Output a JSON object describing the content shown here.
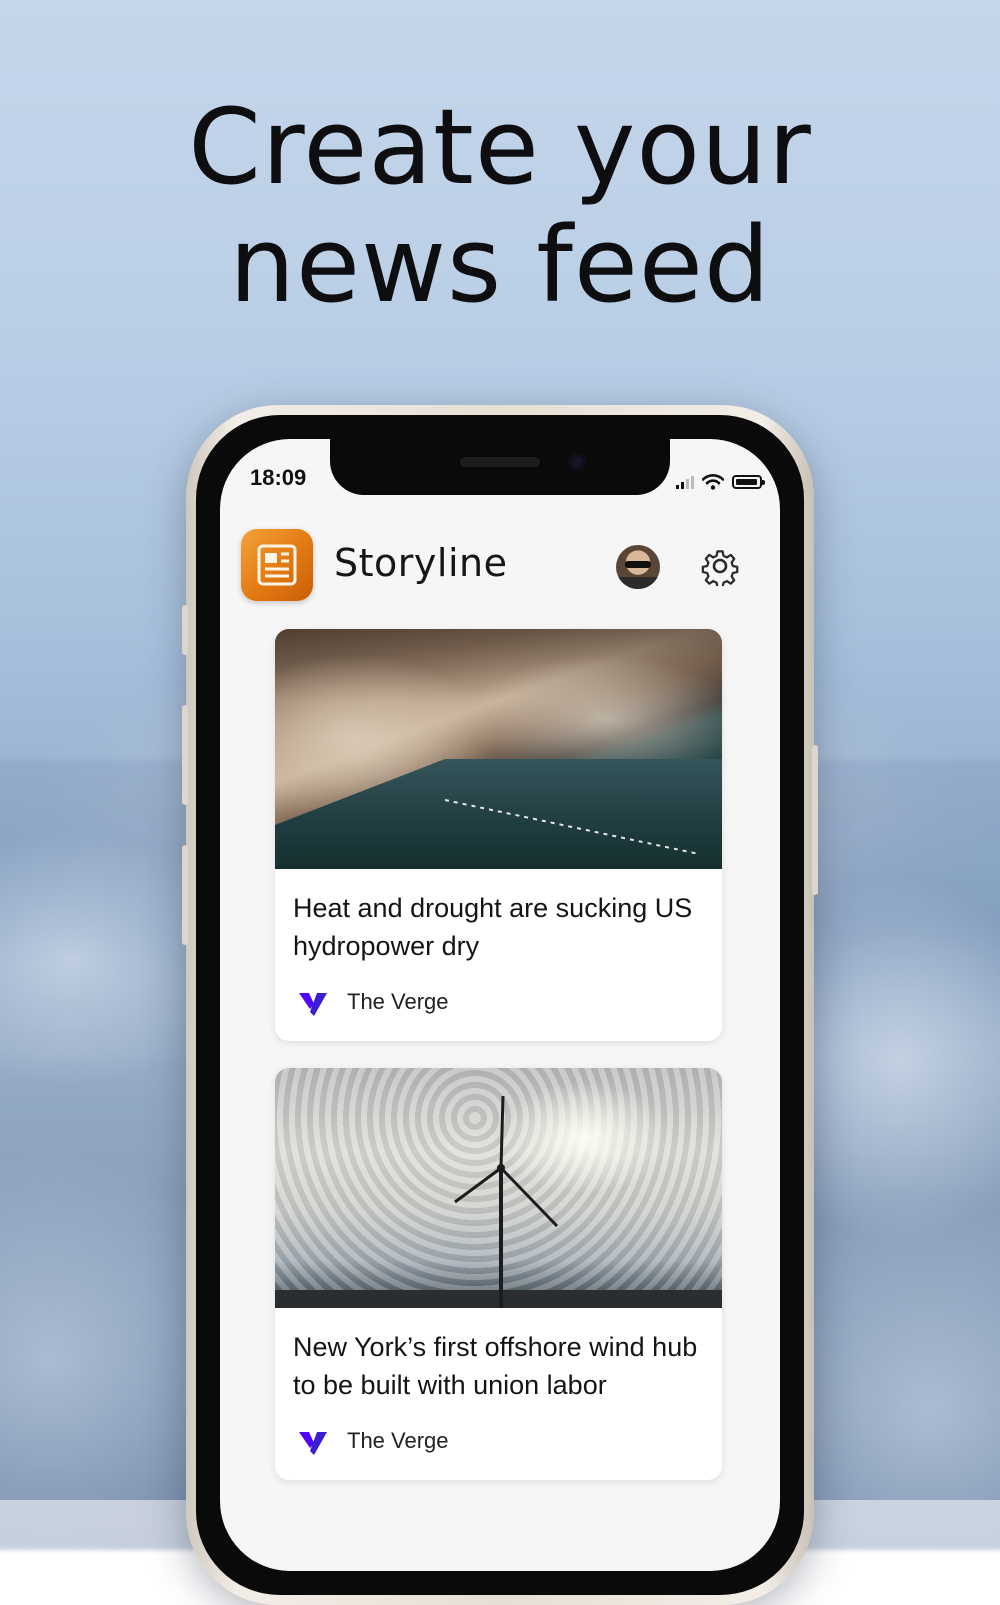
{
  "headline": {
    "line1": "Create your",
    "line2": "news feed"
  },
  "status_bar": {
    "time": "18:09",
    "icons": [
      "signal-icon",
      "wifi-icon",
      "battery-icon"
    ]
  },
  "app": {
    "name": "Storyline",
    "icon": "newspaper-icon",
    "accent": "#E37912",
    "header_actions": [
      "avatar",
      "settings-gear-icon"
    ]
  },
  "feed": {
    "articles": [
      {
        "title": "Heat and drought are sucking US hydropower dry",
        "source": "The Verge",
        "image": "canyon-reservoir-photo"
      },
      {
        "title": "New York’s first offshore wind hub to be built with union labor",
        "source": "The Verge",
        "image": "offshore-wind-turbine-photo"
      }
    ]
  }
}
